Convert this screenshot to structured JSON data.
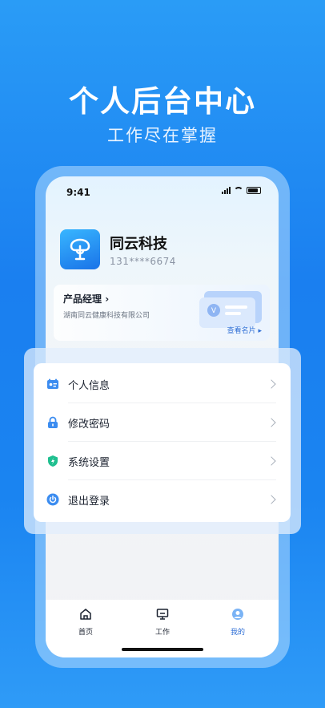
{
  "hero": {
    "title": "个人后台中心",
    "subtitle": "工作尽在掌握"
  },
  "status_bar": {
    "time": "9:41"
  },
  "profile": {
    "company": "同云科技",
    "phone": "131****6674"
  },
  "card": {
    "title": "产品经理",
    "title_chevron": "›",
    "org": "湖南同云健康科技有限公司",
    "link": "查看名片",
    "link_arrow": "▸"
  },
  "menu": {
    "items": [
      {
        "label": "个人信息",
        "icon": "id-card-icon"
      },
      {
        "label": "修改密码",
        "icon": "lock-icon"
      },
      {
        "label": "系统设置",
        "icon": "shield-lightning-icon"
      },
      {
        "label": "退出登录",
        "icon": "power-icon"
      }
    ]
  },
  "tabbar": {
    "tabs": [
      {
        "label": "首页",
        "icon": "home-icon"
      },
      {
        "label": "工作",
        "icon": "monitor-icon"
      },
      {
        "label": "我的",
        "icon": "profile-icon",
        "active": true
      }
    ]
  },
  "colors": {
    "brand_blue": "#1a7ff0",
    "accent": "#2f6fd6",
    "green": "#1fbf8f"
  }
}
